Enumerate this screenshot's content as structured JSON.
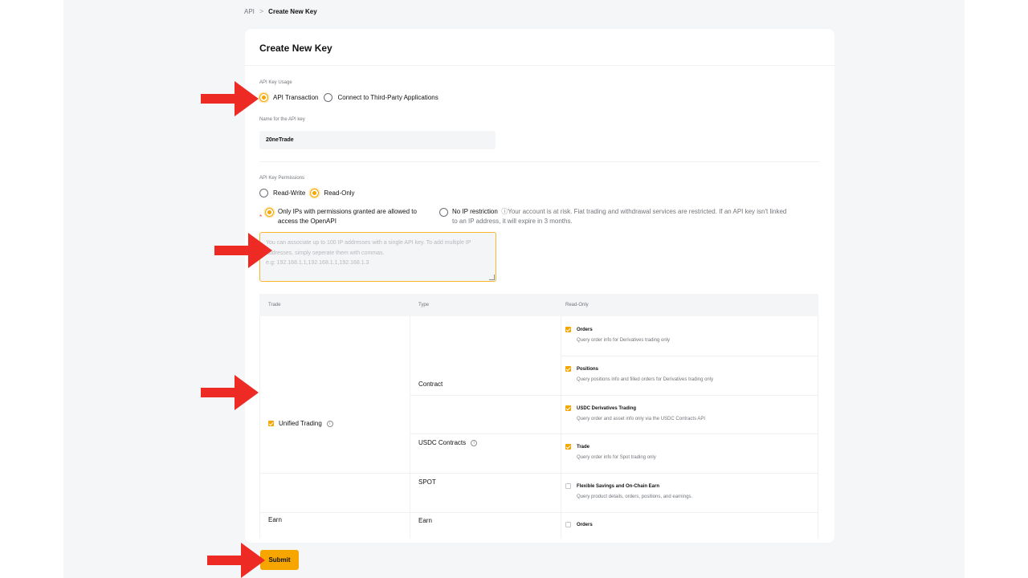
{
  "breadcrumb": {
    "root": "API",
    "separator": ">",
    "current": "Create New Key"
  },
  "card": {
    "title": "Create New Key"
  },
  "usage": {
    "label": "API Key Usage",
    "options": [
      {
        "label": "API Transaction",
        "selected": true
      },
      {
        "label": "Connect to Third-Party Applications",
        "selected": false
      }
    ]
  },
  "name_field": {
    "label": "Name for the API key",
    "value": "20neTrade"
  },
  "permissions": {
    "label": "API Key Permissions",
    "options": [
      {
        "label": "Read-Write",
        "selected": false
      },
      {
        "label": "Read-Only",
        "selected": true
      }
    ]
  },
  "ip": {
    "asterisk": "*",
    "option_ip_line1": "Only IPs with permissions granted are allowed to",
    "option_ip_line2": "access the OpenAPI",
    "option_none": "No IP restriction",
    "warning_line1": "ⓘYour account is at risk. Fiat trading and withdrawal services are restricted. If an API key isn't linked",
    "warning_line2": "to an IP address, it will expire in 3 months.",
    "placeholder": "You can associate up to 100 IP addresses with a single API key. To add multiple IP addresses, simply seperate them with commas.\ne.g: 192.168.1.1,192.168.1.1,192.168.1.3"
  },
  "table": {
    "headers": [
      "Trade",
      "Type",
      "Read-Only"
    ],
    "trade_unified": "Unified Trading",
    "type_contract": "Contract",
    "type_usdc": "USDC Contracts",
    "type_spot": "SPOT",
    "trade_earn": "Earn",
    "type_earn": "Earn",
    "perms": [
      {
        "title": "Orders",
        "desc": "Query order info for Derivatives trading only",
        "checked": true
      },
      {
        "title": "Positions",
        "desc": "Query positions info and filled orders for Derivatives trading only",
        "checked": true
      },
      {
        "title": "USDC Derivatives Trading",
        "desc": "Query order and asset info only via the USDC Contracts API",
        "checked": true
      },
      {
        "title": "Trade",
        "desc": "Query order info for Spot trading only",
        "checked": true
      },
      {
        "title": "Flexible Savings and On-Chain Earn",
        "desc": "Query product details, orders, positions, and earnings.",
        "checked": false
      },
      {
        "title": "Orders",
        "desc": "",
        "checked": false
      }
    ]
  },
  "submit_label": "Submit",
  "colors": {
    "accent": "#f7a600",
    "arrow": "#ee2a24",
    "background": "#f5f6f8"
  }
}
